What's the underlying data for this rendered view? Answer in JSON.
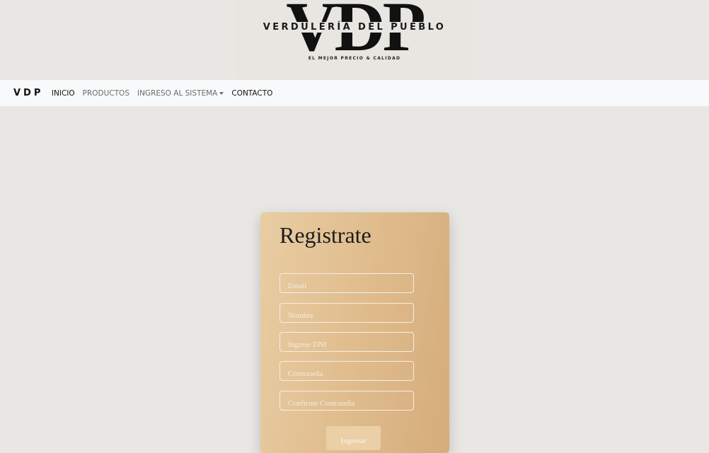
{
  "logo": {
    "mark": "VDP",
    "title": "VERDULERÍA DEL PUEBLO",
    "subtitle": "EL MEJOR PRECIO & CALIDAD"
  },
  "navbar": {
    "brand": "VDP",
    "items": [
      {
        "label": "INICIO"
      },
      {
        "label": "PRODUCTOS"
      },
      {
        "label": "INGRESO AL SISTEMA"
      },
      {
        "label": "CONTACTO"
      }
    ]
  },
  "form": {
    "title": "Registrate",
    "fields": [
      {
        "placeholder": "Email"
      },
      {
        "placeholder": "Nombre"
      },
      {
        "placeholder": "Ingrese DNI"
      },
      {
        "placeholder": "Contraseña"
      },
      {
        "placeholder": "Confirme Contraseña"
      }
    ],
    "submit_label": "Ingresar"
  }
}
